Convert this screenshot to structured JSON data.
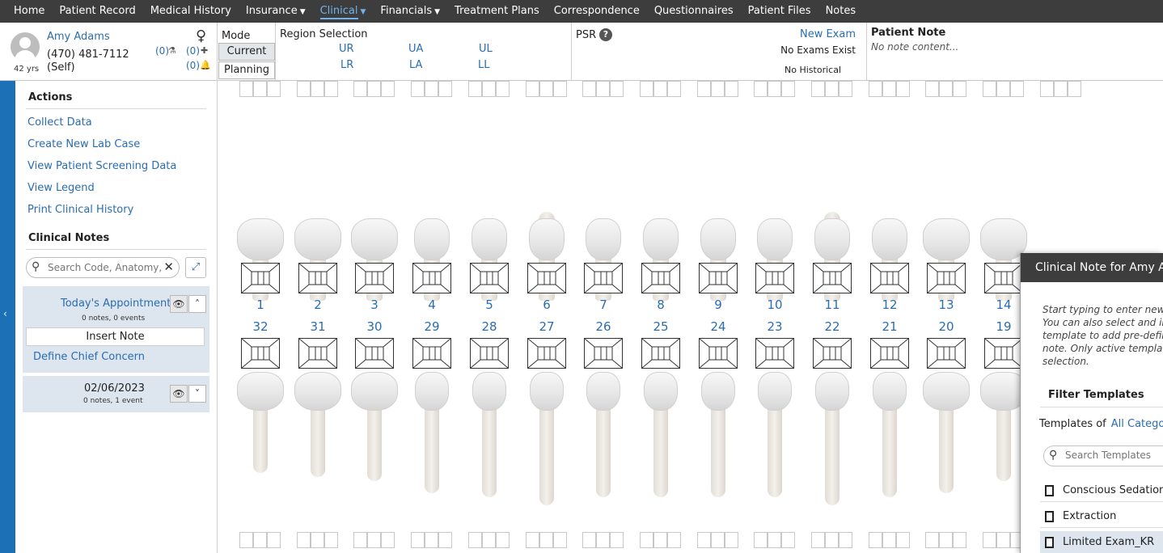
{
  "nav": {
    "items": [
      {
        "label": "Home",
        "caret": false,
        "active": false
      },
      {
        "label": "Patient Record",
        "caret": false,
        "active": false
      },
      {
        "label": "Medical History",
        "caret": false,
        "active": false
      },
      {
        "label": "Insurance",
        "caret": true,
        "active": false
      },
      {
        "label": "Clinical",
        "caret": true,
        "active": true
      },
      {
        "label": "Financials",
        "caret": true,
        "active": false
      },
      {
        "label": "Treatment Plans",
        "caret": false,
        "active": false
      },
      {
        "label": "Correspondence",
        "caret": false,
        "active": false
      },
      {
        "label": "Questionnaires",
        "caret": false,
        "active": false
      },
      {
        "label": "Patient Files",
        "caret": false,
        "active": false
      },
      {
        "label": "Notes",
        "caret": false,
        "active": false
      }
    ]
  },
  "patient": {
    "name": "Amy Adams",
    "phone": "(470) 481-7112",
    "relation": "(Self)",
    "age": "42 yrs",
    "gender_symbol": "♀",
    "count_lab": "(0)",
    "count_medical": "(0)",
    "count_alert": "(0)"
  },
  "mode": {
    "label": "Mode",
    "current": "Current",
    "planning": "Planning"
  },
  "region": {
    "label": "Region Selection",
    "buttons": [
      "UR",
      "UA",
      "UL",
      "LR",
      "LA",
      "LL"
    ]
  },
  "psr": {
    "label": "PSR",
    "new_exam": "New Exam",
    "no_exams": "No Exams Exist",
    "no_historical": "No Historical"
  },
  "patient_note": {
    "title": "Patient Note",
    "content": "No note content..."
  },
  "sidebar": {
    "actions_title": "Actions",
    "actions": [
      "Collect Data",
      "Create New Lab Case",
      "View Patient Screening Data",
      "View Legend",
      "Print Clinical History"
    ],
    "clinical_notes_title": "Clinical Notes",
    "search_placeholder": "Search Code, Anatomy, Tags",
    "today": {
      "title": "Today's Appointment",
      "sub": "0 notes,  0 events",
      "insert": "Insert Note",
      "define": "Define Chief Concern"
    },
    "past": {
      "date": "02/06/2023",
      "sub": "0 notes,  1 event"
    }
  },
  "teeth": {
    "upper": [
      "1",
      "2",
      "3",
      "4",
      "5",
      "6",
      "7",
      "8",
      "9",
      "10",
      "11",
      "12",
      "13",
      "14"
    ],
    "lower": [
      "32",
      "31",
      "30",
      "29",
      "28",
      "27",
      "26",
      "25",
      "24",
      "23",
      "22",
      "21",
      "20",
      "19"
    ]
  },
  "clinical_note_panel": {
    "title": "Clinical Note for Amy Adams",
    "help": "Start typing to enter new free\nYou can also select and insert\ntemplate to add pre-defined\nnote. Only active templates\nselection.",
    "filter_title": "Filter Templates",
    "templates_of": "Templates of",
    "category": "All Categories",
    "search_placeholder": "Search Templates",
    "templates": [
      "Conscious Sedation",
      "Extraction",
      "Limited Exam_KR"
    ]
  },
  "colors": {
    "nav_bg": "#3d3d3d",
    "link": "#2a6db0",
    "active_nav": "#6fb3ea",
    "left_bar": "#1c70b6"
  }
}
